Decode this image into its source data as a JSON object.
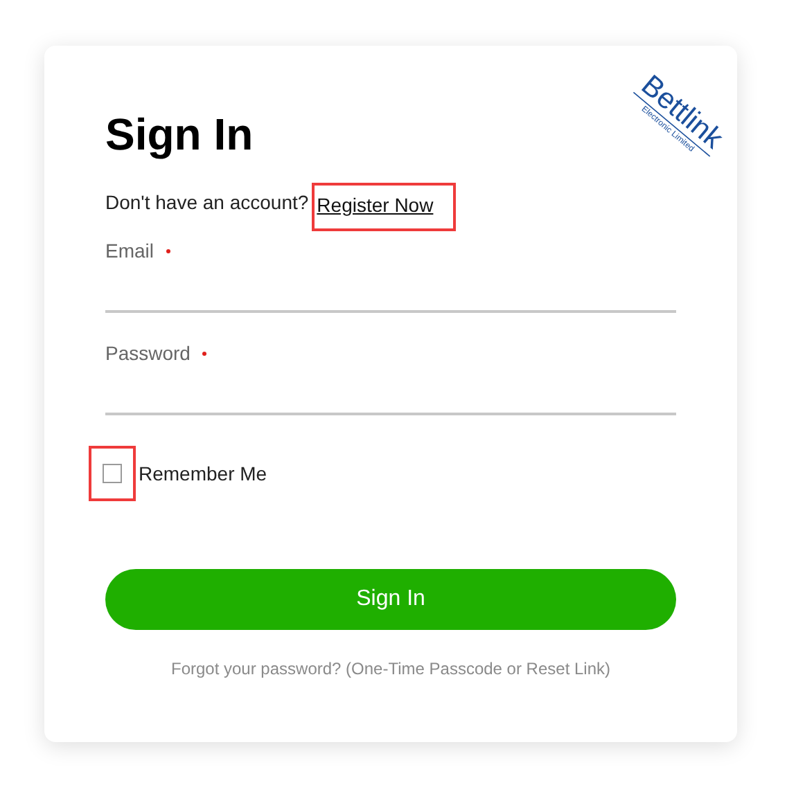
{
  "logo": {
    "name": "Bettlink",
    "tagline": "Electronic Limited"
  },
  "title": "Sign In",
  "register_prompt": {
    "text": "Don't have an account?",
    "link": "Register Now",
    "highlighted": true
  },
  "fields": [
    {
      "label": "Email",
      "required": true
    },
    {
      "label": "Password",
      "required": true
    }
  ],
  "remember_me": {
    "label": "Remember Me",
    "checked": false,
    "highlighted": true
  },
  "submit_button": "Sign In",
  "forgot_link": "Forgot your password? (One-Time Passcode or Reset Link)"
}
